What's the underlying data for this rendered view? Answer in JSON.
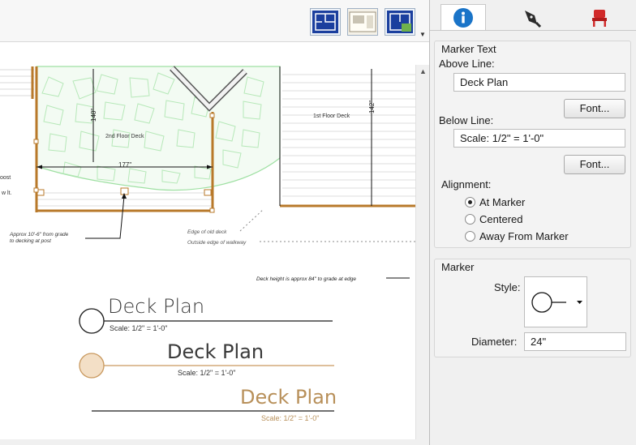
{
  "toolbar": {
    "buttons": [
      {
        "icon": "floor-plan-view-icon"
      },
      {
        "icon": "layout-sheet-icon"
      },
      {
        "icon": "elevation-view-icon"
      }
    ],
    "more_icon": "dropdown-arrow-icon"
  },
  "drawing": {
    "room_labels": [
      "2nd Floor Deck",
      "1st Floor Deck"
    ],
    "dimensions": [
      "148\"",
      "177\"",
      "142\""
    ],
    "notes": [
      "Approx 10'-6\" from grade",
      "to decking at post",
      "Edge of old deck",
      "Outside edge of walkway",
      "Deck height is approx 84\" to grade at edge"
    ],
    "cut_text": [
      "oost",
      "w lt."
    ],
    "markers": [
      {
        "title": "Deck Plan",
        "subtitle": "Scale: 1/2\" = 1'-0\"",
        "alignment": "At Marker",
        "fill": "#ffffff",
        "stroke": "#1a1a1a",
        "text_color": "#3a3a3a"
      },
      {
        "title": "Deck Plan",
        "subtitle": "Scale: 1/2\" = 1'-0\"",
        "alignment": "Centered",
        "fill": "#f3dfc6",
        "stroke": "#c9995f",
        "text_color": "#3a3a3a"
      },
      {
        "title": "Deck Plan",
        "subtitle": "Scale: 1/2\" = 1'-0\"",
        "alignment": "Away From Marker",
        "fill": "none",
        "stroke": "#1a1a1a",
        "text_color": "#b8905a"
      }
    ]
  },
  "panel": {
    "tabs": [
      {
        "icon": "info-icon",
        "active": true
      },
      {
        "icon": "pen-nib-icon",
        "active": false
      },
      {
        "icon": "chair-icon",
        "active": false
      }
    ],
    "marker_text": {
      "title": "Marker Text",
      "above_line_label": "Above Line:",
      "above_line_value": "Deck Plan",
      "below_line_label": "Below Line:",
      "below_line_value": "Scale: 1/2\" = 1'-0\"",
      "font_button": "Font...",
      "alignment_label": "Alignment:",
      "alignment_options": [
        "At Marker",
        "Centered",
        "Away From Marker"
      ],
      "alignment_selected": "At Marker"
    },
    "marker": {
      "title": "Marker",
      "style_label": "Style:",
      "diameter_label": "Diameter:",
      "diameter_value": "24\""
    }
  },
  "colors": {
    "deck_wood": "#b8792a",
    "stone_green": "#9fe0a3",
    "info_blue": "#1a74c8",
    "chair_red": "#d12a2a"
  }
}
